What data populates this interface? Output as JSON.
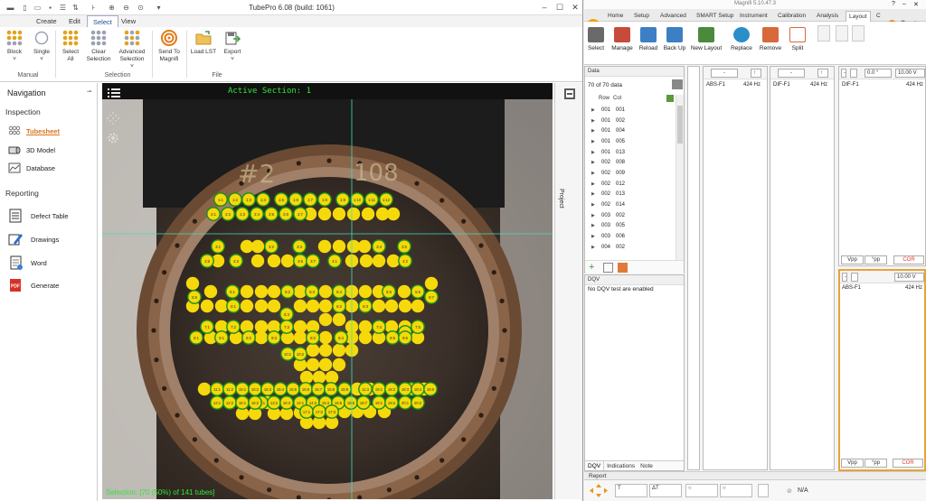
{
  "left_app": {
    "window_title": "TubePro 6.08 (build: 1061)",
    "tabs": [
      "Create",
      "Edit",
      "Select",
      "View"
    ],
    "selected_tab": "Select",
    "ribbon": {
      "buttons": [
        {
          "label": "Block",
          "sub": "˅"
        },
        {
          "label": "Single",
          "sub": "˅"
        },
        {
          "label": "Select\nAll"
        },
        {
          "label": "Clear\nSelection"
        },
        {
          "label": "Advanced\nSelection",
          "sub": "˅"
        },
        {
          "label": "Send To\nMagnifi"
        },
        {
          "label": "Load LST"
        },
        {
          "label": "Export",
          "sub": "˅"
        }
      ],
      "groups": [
        "Manual",
        "Selection",
        "File"
      ]
    },
    "navigation": {
      "title": "Navigation",
      "inspection_header": "Inspection",
      "inspection_items": [
        "Tubesheet",
        "3D Model",
        "Database"
      ],
      "active_item": "Tubesheet",
      "reporting_header": "Reporting",
      "reporting_items": [
        "Defect Table",
        "Drawings",
        "Word",
        "Generate"
      ]
    },
    "viewport": {
      "active_section": "Active Section: 1",
      "status": "Selection: [70 (50%) of 141 tubes]",
      "painted_marks": [
        "#2",
        "108"
      ],
      "selected_color": "#f5d90a",
      "unselected_color": "#f5d90a",
      "ring_color": "#168f1c",
      "crosshair_color": "#3de0c0"
    },
    "side_panel_label": "Project",
    "tube_labels": {
      "row1": [
        "1:1",
        "1:2",
        "1:3",
        "1:4",
        "1:5",
        "1:6",
        "1:7",
        "1:8",
        "1:9",
        "1:10",
        "1:11",
        "1:12"
      ],
      "row2": [
        "2:1",
        "2:2",
        "2:3",
        "2:4",
        "2:5",
        "2:6",
        "2:7"
      ],
      "row3": [
        "3:1",
        "3:2",
        "3:3",
        "3:4",
        "3:5",
        "3:6",
        "3:7",
        "3:8"
      ],
      "row4": [
        "4:1",
        "4:2",
        "4:3"
      ],
      "row5": [
        "5:1",
        "5:2",
        "5:3",
        "5:4",
        "5:5",
        "5:6",
        "5:7",
        "5:8"
      ],
      "row6": [
        "6:1",
        "6:2",
        "6:3",
        "6:4"
      ],
      "row7": [
        "7:1",
        "7:2",
        "7:3",
        "7:4",
        "7:5"
      ],
      "row8": [
        "8:1",
        "8:2",
        "8:3"
      ],
      "row9": [
        "9:1",
        "9:2",
        "9:3",
        "9:4",
        "9:5",
        "9:6"
      ],
      "row10": [
        "10:1",
        "10:2"
      ],
      "row11": [
        "11:1",
        "11:2",
        "11:3",
        "11:4"
      ],
      "row12": [
        "12:1",
        "12:2"
      ],
      "row13": [
        "13:1",
        "13:2"
      ],
      "row14": [
        "14:1",
        "14:2"
      ],
      "row15": [
        "15:1",
        "15:2",
        "15:3",
        "15:4",
        "15:5",
        "15:6",
        "15:7",
        "15:8",
        "15:9"
      ],
      "row16": [
        "16:1",
        "16:2",
        "16:3",
        "16:4",
        "16:5",
        "16:6",
        "16:7"
      ],
      "row17": [
        "17:1",
        "17:2",
        "17:3"
      ],
      "row18": [
        "18:1",
        "18:2",
        "18:3",
        "18:4",
        "18:5"
      ],
      "row19": [
        "19:1",
        "19:2"
      ],
      "row20": [
        "20:1",
        "20:2"
      ]
    }
  },
  "right_app": {
    "window_title": "Magnifi 5.10.47.3",
    "tabs": [
      "Home",
      "Setup",
      "Advanced",
      "SMART Setup",
      "Instrument",
      "Calibration",
      "Analysis",
      "Layout",
      "C"
    ],
    "selected_tab": "Layout",
    "ribbon_buttons": [
      "Select",
      "Manage",
      "Reload",
      "Back Up",
      "New Layout",
      "Replace",
      "Remove",
      "Split"
    ],
    "data_panel": {
      "title": "Data",
      "count": "70 of 70 data",
      "col_row": "Row",
      "col_col": "Col",
      "rows": [
        [
          "001",
          "001"
        ],
        [
          "001",
          "002"
        ],
        [
          "001",
          "004"
        ],
        [
          "001",
          "005"
        ],
        [
          "001",
          "013"
        ],
        [
          "002",
          "008"
        ],
        [
          "002",
          "009"
        ],
        [
          "002",
          "012"
        ],
        [
          "002",
          "013"
        ],
        [
          "002",
          "014"
        ],
        [
          "003",
          "002"
        ],
        [
          "003",
          "005"
        ],
        [
          "003",
          "006"
        ],
        [
          "004",
          "002"
        ]
      ]
    },
    "dqv_panel": {
      "title": "DQV",
      "message": "No DQV test are enabled",
      "tabs": [
        "DQV",
        "Indications",
        "Note"
      ]
    },
    "report_label": "Report",
    "strip_charts": [
      {
        "channel": "ABS-F1",
        "freq": "424 Hz"
      },
      {
        "channel": "DIF-F1",
        "freq": "424 Hz"
      },
      {
        "channel": "DIF-F1",
        "freq": "424 Hz"
      }
    ],
    "lissajous_top": {
      "angle": "0.0 °",
      "scale": "10.00 V",
      "btn_vpp": "Vpp",
      "btn_pp": "°pp",
      "btn_cor": "COR"
    },
    "lissajous_bottom": {
      "channel": "ABS-F1",
      "freq": "424 Hz",
      "scale": "10.00 V",
      "btn_vpp": "Vpp",
      "btn_pp": "°pp",
      "btn_cor": "COR"
    },
    "bottom_bar": {
      "t": "T",
      "dt": "ΔT",
      "na": "N/A"
    }
  }
}
